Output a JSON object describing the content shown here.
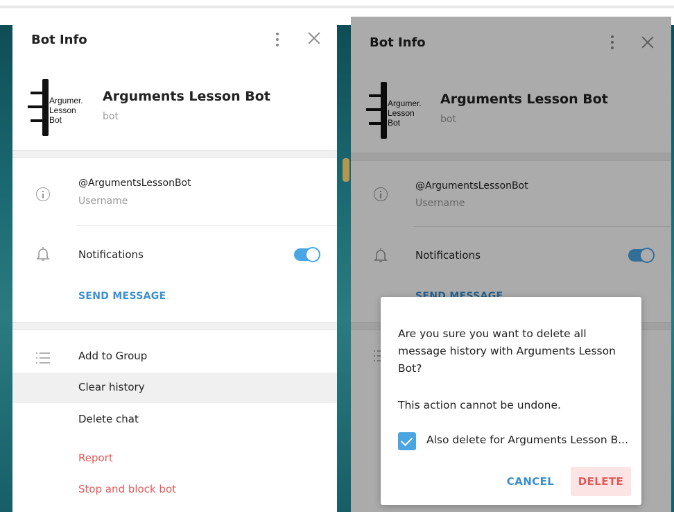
{
  "left_panel": {
    "header_title": "Bot Info",
    "logo": {
      "line1": "Argumer.",
      "line2": "Lesson",
      "line3": "Bot"
    },
    "name": "Arguments Lesson Bot",
    "subtitle": "bot",
    "username": "@ArgumentsLessonBot",
    "username_label": "Username",
    "notifications_label": "Notifications",
    "notifications_on": true,
    "send_message": "SEND MESSAGE",
    "menu": {
      "add_to_group": "Add to Group",
      "clear_history": "Clear history",
      "delete_chat": "Delete chat",
      "report": "Report",
      "stop_block": "Stop and block bot"
    }
  },
  "right_panel": {
    "header_title": "Bot Info",
    "logo": {
      "line1": "Argumer.",
      "line2": "Lesson",
      "line3": "Bot"
    },
    "name": "Arguments Lesson Bot",
    "subtitle": "bot",
    "username": "@ArgumentsLessonBot",
    "username_label": "Username",
    "notifications_label": "Notifications",
    "send_message": "SEND MESSAGE"
  },
  "dialog": {
    "question": "Are you sure you want to delete all message history with Arguments Lesson Bot?",
    "warning": "This action cannot be undone.",
    "checkbox_label": "Also delete for Arguments Lesson B...",
    "checkbox_checked": true,
    "cancel": "CANCEL",
    "delete": "DELETE"
  },
  "colors": {
    "accent": "#3b8fd0",
    "toggle": "#49a5e3",
    "danger": "#e05a5a",
    "background_teal": "#1b6a73"
  }
}
